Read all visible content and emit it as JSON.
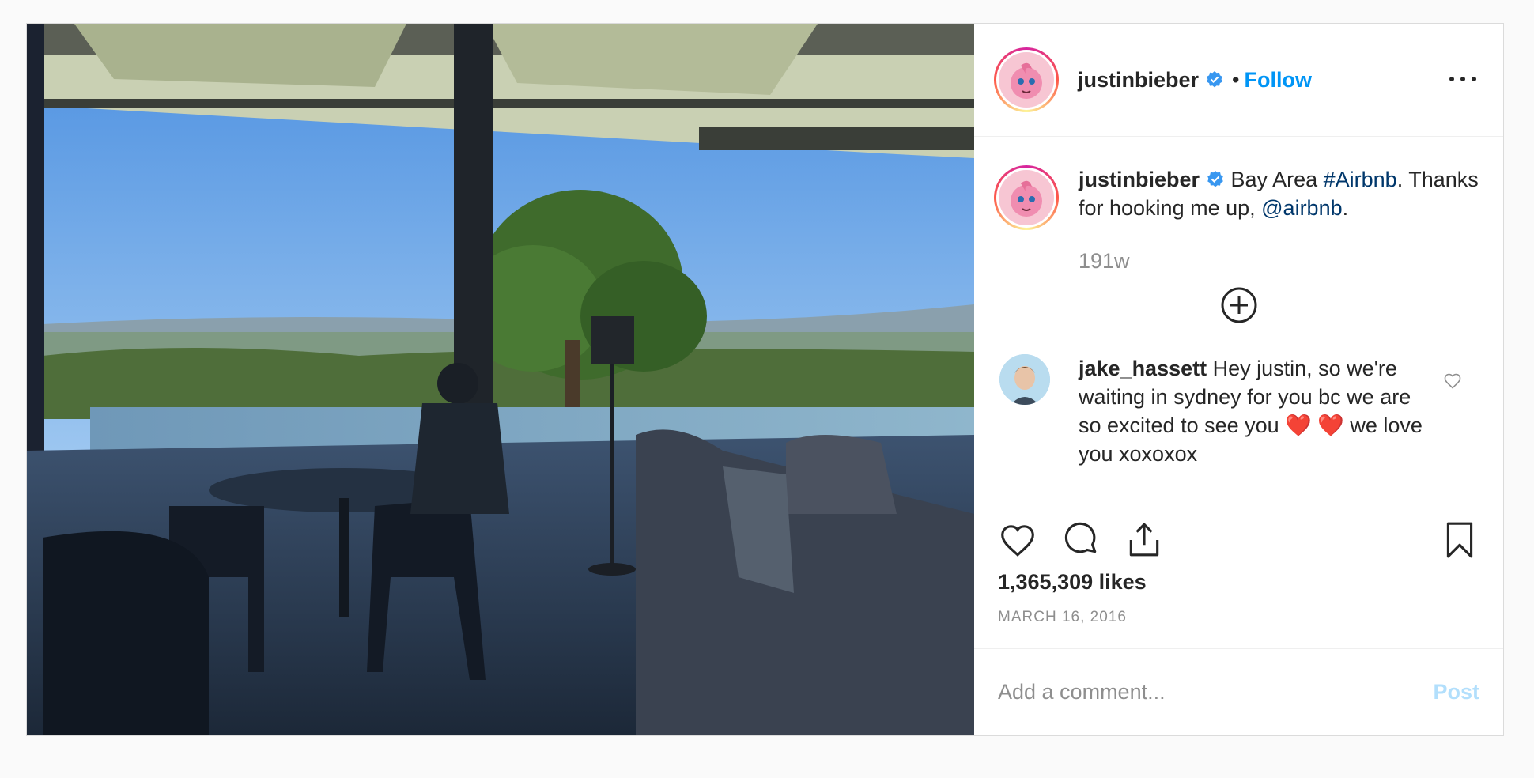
{
  "post": {
    "author": "justinbieber",
    "follow_label": "Follow",
    "separator": "•",
    "caption_parts": {
      "text_before": " Bay Area ",
      "hashtag": "#Airbnb",
      "text_middle": ". Thanks for hooking me up, ",
      "mention": "@airbnb",
      "text_after": "."
    },
    "time_ago": "191w",
    "likes": "1,365,309 likes",
    "date": "MARCH 16, 2016"
  },
  "comment": {
    "username": "jake_hassett",
    "text": " Hey justin, so we're waiting in sydney for you bc we are so excited to see you ❤️ ❤️ we love you xoxoxox"
  },
  "composer": {
    "placeholder": "Add a comment...",
    "post_label": "Post"
  },
  "colors": {
    "accent": "#0095f6",
    "link": "#00376b",
    "muted": "#8e8e8e",
    "post_disabled": "#b2dffc",
    "verified": "#3897f0"
  },
  "icons": {
    "header": [
      "verified-badge-icon",
      "more-options-icon"
    ],
    "actions": [
      "heart-icon",
      "comment-icon",
      "share-icon",
      "bookmark-icon"
    ],
    "misc": [
      "load-more-plus-icon",
      "comment-like-heart-icon"
    ]
  }
}
